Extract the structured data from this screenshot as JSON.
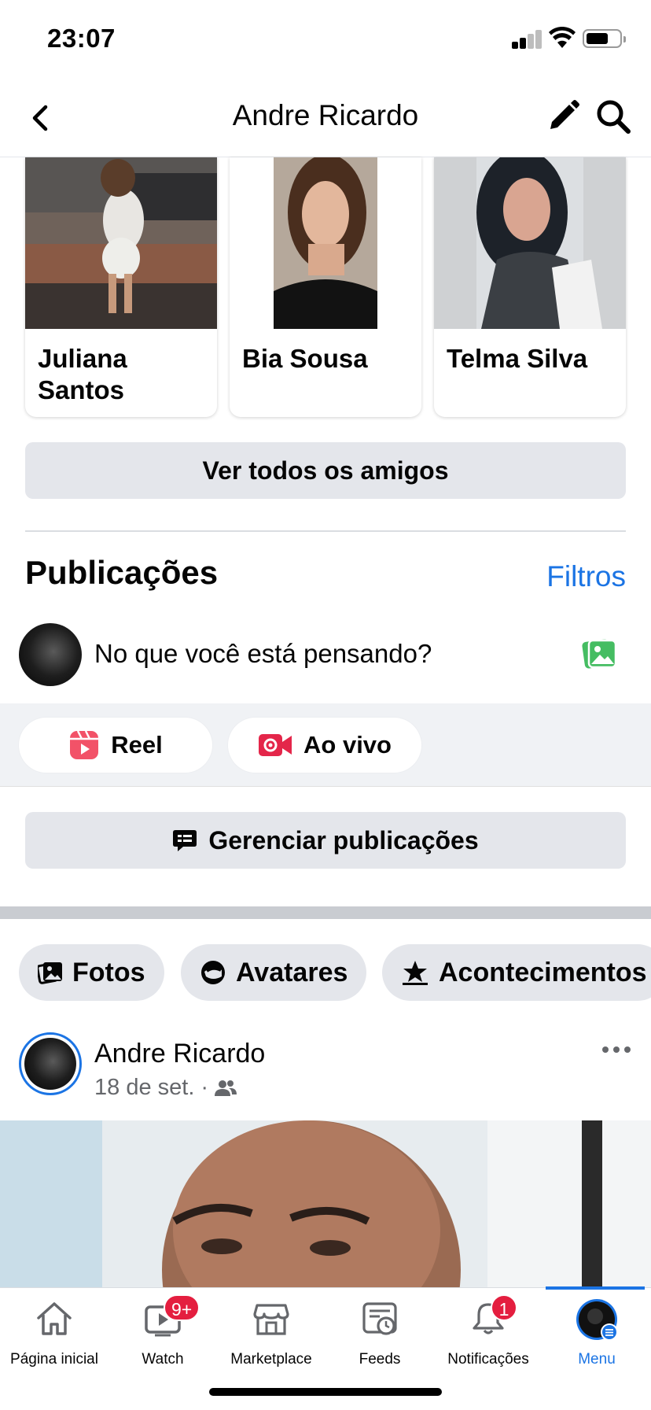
{
  "status_bar": {
    "time": "23:07"
  },
  "header": {
    "title": "Andre Ricardo"
  },
  "friends": [
    {
      "name": "Juliana Santos"
    },
    {
      "name": "Bia Sousa"
    },
    {
      "name": "Telma Silva"
    }
  ],
  "see_all_friends_label": "Ver todos os amigos",
  "posts_section": {
    "title": "Publicações",
    "filters_label": "Filtros",
    "composer_placeholder": "No que você está pensando?"
  },
  "actions": {
    "reel_label": "Reel",
    "live_label": "Ao vivo"
  },
  "manage_posts_label": "Gerenciar publicações",
  "chips": [
    "Fotos",
    "Avatares",
    "Acontecimentos"
  ],
  "post": {
    "author": "Andre Ricardo",
    "date": "18 de set.",
    "separator": "·"
  },
  "tab_bar": {
    "tabs": [
      {
        "label": "Página inicial",
        "icon": "home-icon"
      },
      {
        "label": "Watch",
        "icon": "watch-icon",
        "badge": "9+"
      },
      {
        "label": "Marketplace",
        "icon": "marketplace-icon"
      },
      {
        "label": "Feeds",
        "icon": "feeds-icon"
      },
      {
        "label": "Notificações",
        "icon": "bell-icon",
        "badge": "1"
      },
      {
        "label": "Menu",
        "icon": "menu-avatar-icon"
      }
    ],
    "active": "Menu",
    "accent_color": "#1b74e4",
    "badge_color": "#e41e3f"
  }
}
